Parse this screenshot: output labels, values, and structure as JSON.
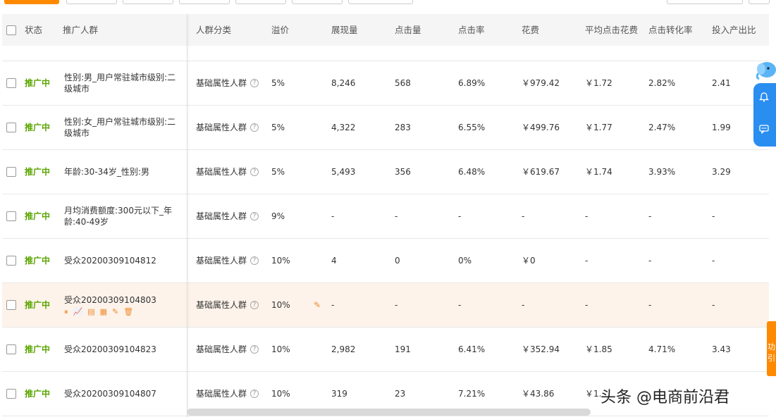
{
  "header": {
    "status": "状态",
    "audience": "推广人群",
    "category": "人群分类",
    "premium": "溢价",
    "impressions": "展现量",
    "clicks": "点击量",
    "ctr": "点击率",
    "cost": "花费",
    "avg_cpc": "平均点击花费",
    "cvr": "点击转化率",
    "roi": "投入产出比"
  },
  "rows": [
    {
      "status": "推广中",
      "name": "性别:男_用户常驻城市级别:二级城市",
      "category": "基础属性人群",
      "premium": "5%",
      "impressions": "8,246",
      "clicks": "568",
      "ctr": "6.89%",
      "cost": "￥979.42",
      "avg_cpc": "￥1.72",
      "cvr": "2.82%",
      "roi": "2.41"
    },
    {
      "status": "推广中",
      "name": "性别:女_用户常驻城市级别:二级城市",
      "category": "基础属性人群",
      "premium": "5%",
      "impressions": "4,322",
      "clicks": "283",
      "ctr": "6.55%",
      "cost": "￥499.76",
      "avg_cpc": "￥1.77",
      "cvr": "2.47%",
      "roi": "1.99"
    },
    {
      "status": "推广中",
      "name": "年龄:30-34岁_性别:男",
      "category": "基础属性人群",
      "premium": "5%",
      "impressions": "5,493",
      "clicks": "356",
      "ctr": "6.48%",
      "cost": "￥619.67",
      "avg_cpc": "￥1.74",
      "cvr": "3.93%",
      "roi": "3.29"
    },
    {
      "status": "推广中",
      "name": "月均消费额度:300元以下_年龄:40-49岁",
      "category": "基础属性人群",
      "premium": "9%",
      "impressions": "-",
      "clicks": "-",
      "ctr": "-",
      "cost": "-",
      "avg_cpc": "-",
      "cvr": "-",
      "roi": "-"
    },
    {
      "status": "推广中",
      "name": "受众20200309104812",
      "category": "基础属性人群",
      "premium": "10%",
      "impressions": "4",
      "clicks": "0",
      "ctr": "0%",
      "cost": "￥0",
      "avg_cpc": "-",
      "cvr": "-",
      "roi": "-"
    },
    {
      "status": "推广中",
      "name": "受众20200309104803",
      "category": "基础属性人群",
      "premium": "10%",
      "impressions": "-",
      "clicks": "-",
      "ctr": "-",
      "cost": "-",
      "avg_cpc": "-",
      "cvr": "-",
      "roi": "-"
    },
    {
      "status": "推广中",
      "name": "受众20200309104823",
      "category": "基础属性人群",
      "premium": "10%",
      "impressions": "2,982",
      "clicks": "191",
      "ctr": "6.41%",
      "cost": "￥352.94",
      "avg_cpc": "￥1.85",
      "cvr": "4.71%",
      "roi": "3.43"
    },
    {
      "status": "推广中",
      "name": "受众20200309104807",
      "category": "基础属性人群",
      "premium": "10%",
      "impressions": "319",
      "clicks": "23",
      "ctr": "7.21%",
      "cost": "￥43.86",
      "avg_cpc": "￥1.",
      "cvr": "",
      "roi": ""
    }
  ],
  "side_tab": "功引",
  "watermark": "头条 @电商前沿君",
  "colors": {
    "accent": "#ff8a00",
    "status": "#5aa500",
    "float_panel": "#2a8ef0"
  },
  "icons": {
    "row_ops": [
      "pause-icon",
      "chart-icon",
      "report-icon",
      "document-icon",
      "edit-icon",
      "delete-icon"
    ],
    "float": [
      "bell-icon",
      "chat-icon"
    ]
  }
}
